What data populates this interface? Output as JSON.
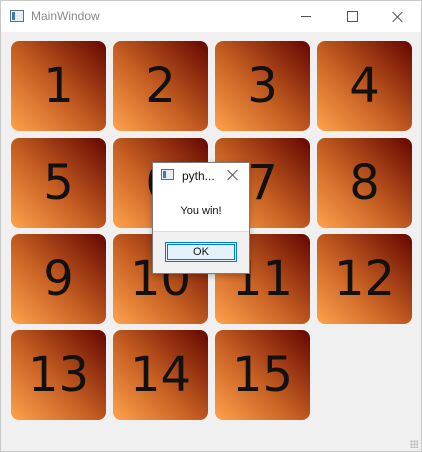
{
  "window": {
    "title": "MainWindow"
  },
  "tiles": [
    "1",
    "2",
    "3",
    "4",
    "5",
    "6",
    "7",
    "8",
    "9",
    "10",
    "11",
    "12",
    "13",
    "14",
    "15"
  ],
  "dialog": {
    "title": "pyth...",
    "message": "You win!",
    "ok_label": "OK"
  },
  "colors": {
    "tile_light": "#ffa24d",
    "tile_mid": "#c65f22",
    "tile_dark": "#650600",
    "accent": "#0078d7"
  }
}
